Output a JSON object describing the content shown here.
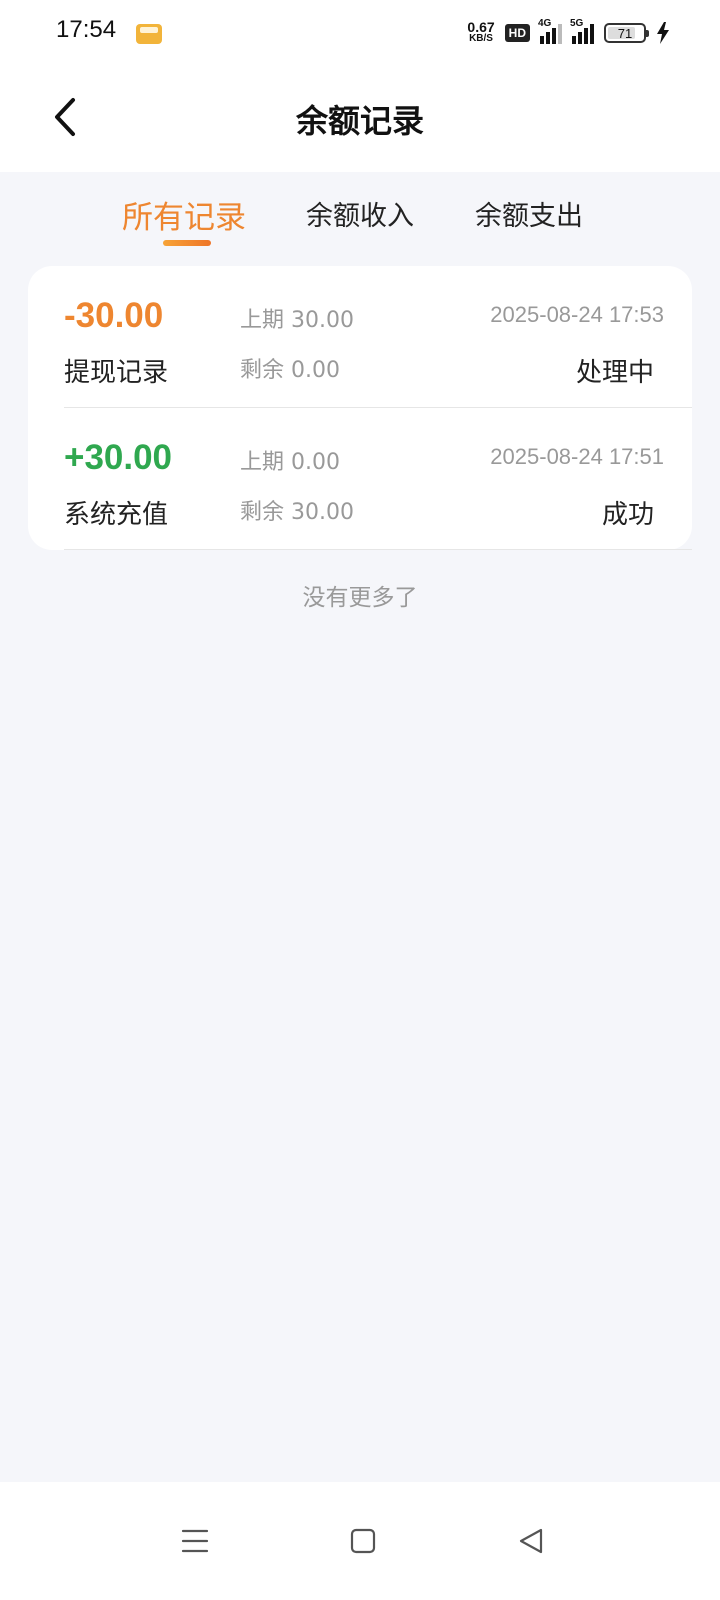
{
  "status_bar": {
    "time": "17:54",
    "net_speed_value": "0.67",
    "net_speed_unit": "KB/S",
    "hd_label": "HD",
    "net1_label": "4G",
    "net2_label": "5G",
    "battery_level": "71"
  },
  "header": {
    "title": "余额记录"
  },
  "tabs": [
    {
      "label": "所有记录",
      "active": true
    },
    {
      "label": "余额收入",
      "active": false
    },
    {
      "label": "余额支出",
      "active": false
    }
  ],
  "records": [
    {
      "amount": "-30.00",
      "type": "提现记录",
      "previous": "上期 30.00",
      "remaining": "剩余 0.00",
      "time": "2025-08-24 17:53",
      "status": "处理中"
    },
    {
      "amount": "+30.00",
      "type": "系统充值",
      "previous": "上期 0.00",
      "remaining": "剩余 30.00",
      "time": "2025-08-24 17:51",
      "status": "成功"
    }
  ],
  "footer_text": "没有更多了",
  "colors": {
    "accent": "#ee8630",
    "positive": "#2fa84f",
    "background": "#f5f6fa"
  },
  "system_nav": {
    "icons": [
      "menu-icon",
      "home-icon",
      "back-triangle-icon"
    ]
  }
}
